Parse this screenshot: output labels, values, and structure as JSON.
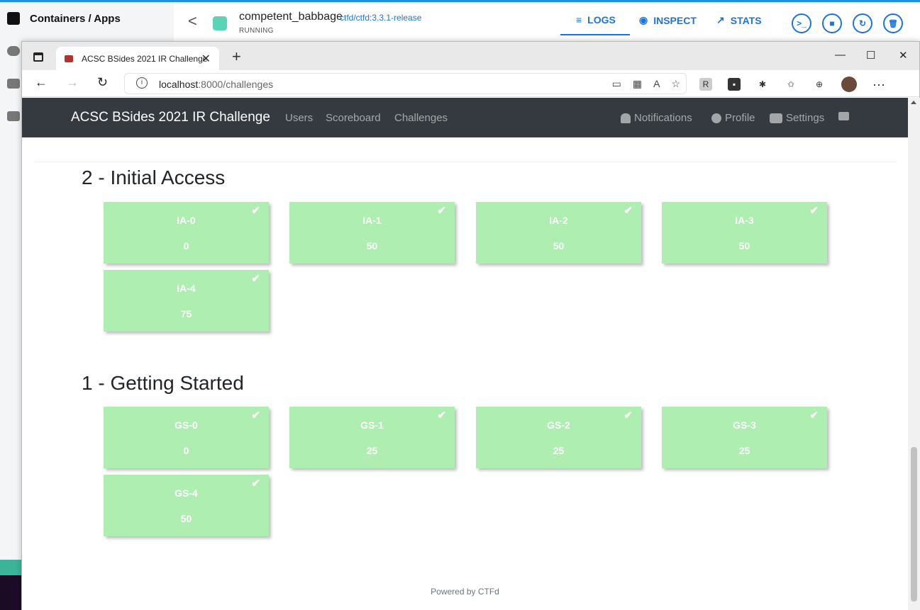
{
  "docker": {
    "sidebar_title": "Containers / Apps",
    "container_name": "competent_babbage",
    "container_image": "ctfd/ctfd:3.3.1-release",
    "container_status": "RUNNING",
    "tabs": {
      "logs": "LOGS",
      "inspect": "INSPECT",
      "stats": "STATS"
    },
    "tab_icons": {
      "logs": "≡",
      "inspect": "◉",
      "stats": "↗"
    },
    "actions": {
      "cli": ">_",
      "stop": "■",
      "restart": "↻",
      "delete": "🗑"
    }
  },
  "browser": {
    "tab_title": "ACSC BSides 2021 IR Challenge",
    "tab_close": "✕",
    "new_tab": "+",
    "window_controls": {
      "minimize": "—",
      "maximize": "☐",
      "close": "✕"
    },
    "nav": {
      "back": "←",
      "forward": "→",
      "reload": "↻"
    },
    "url_host": "localhost",
    "url_rest": ":8000/challenges",
    "addr_icons": [
      "▭",
      "▦",
      "A",
      "☆"
    ],
    "ext_icons": [
      "R",
      "▪",
      "✱",
      "✩",
      "⊕"
    ],
    "more": "···",
    "info": "i"
  },
  "ctfd": {
    "brand": "ACSC BSides 2021 IR Challenge",
    "nav_left": [
      "Users",
      "Scoreboard",
      "Challenges"
    ],
    "nav_right": {
      "notifications": "Notifications",
      "profile": "Profile",
      "settings": "Settings"
    },
    "categories": [
      {
        "title": "2 - Initial Access",
        "challenges": [
          {
            "name": "IA-0",
            "value": "0"
          },
          {
            "name": "IA-1",
            "value": "50"
          },
          {
            "name": "IA-2",
            "value": "50"
          },
          {
            "name": "IA-3",
            "value": "50"
          },
          {
            "name": "IA-4",
            "value": "75"
          }
        ]
      },
      {
        "title": "1 - Getting Started",
        "challenges": [
          {
            "name": "GS-0",
            "value": "0"
          },
          {
            "name": "GS-1",
            "value": "25"
          },
          {
            "name": "GS-2",
            "value": "25"
          },
          {
            "name": "GS-3",
            "value": "25"
          },
          {
            "name": "GS-4",
            "value": "50"
          }
        ]
      }
    ],
    "solved_mark": "✔",
    "footer": "Powered by CTFd"
  }
}
